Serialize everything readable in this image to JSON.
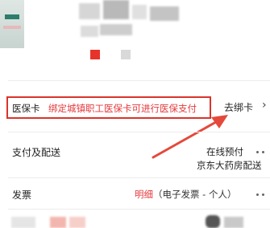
{
  "colors": {
    "accent": "#e4393c",
    "highlight_box": "#d9342b",
    "arrow": "#e4493b"
  },
  "medical_card": {
    "label": "医保卡",
    "description": "绑定城镇职工医保卡可进行医保支付",
    "bind_link": "去绑卡",
    "chevron_icon": "chevron-right-icon"
  },
  "payment": {
    "label": "支付及配送",
    "method": "在线预付",
    "delivery": "京东大药房配送"
  },
  "invoice": {
    "label": "发票",
    "detail": "明细",
    "type": "（电子发票 - 个人）"
  }
}
